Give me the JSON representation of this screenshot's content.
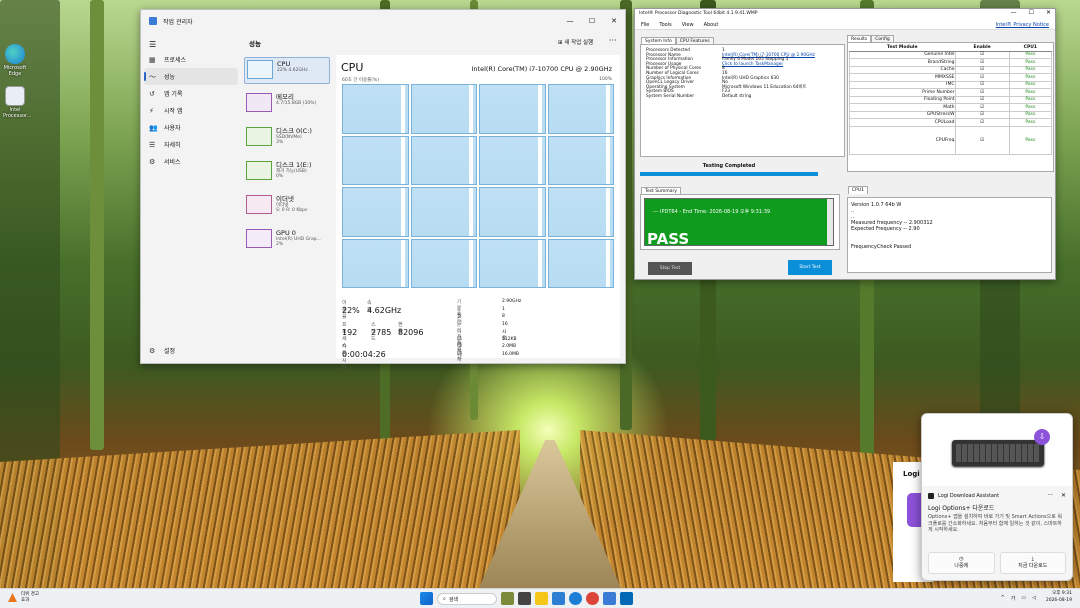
{
  "desktop": {
    "icons": [
      {
        "label": "Microsoft Edge"
      },
      {
        "label": "Intel Processor..."
      }
    ]
  },
  "taskmgr": {
    "title": "작업 관리자",
    "window_controls": [
      "—",
      "☐",
      "✕"
    ],
    "nav": [
      {
        "icon": "processes-icon",
        "glyph": "▦",
        "label": "프로세스"
      },
      {
        "icon": "performance-icon",
        "glyph": "〜",
        "label": "성능"
      },
      {
        "icon": "app-history-icon",
        "glyph": "↺",
        "label": "앱 기록"
      },
      {
        "icon": "startup-icon",
        "glyph": "⚡",
        "label": "시작 앱"
      },
      {
        "icon": "users-icon",
        "glyph": "👥",
        "label": "사용자"
      },
      {
        "icon": "details-icon",
        "glyph": "☰",
        "label": "자세히"
      },
      {
        "icon": "services-icon",
        "glyph": "⚙",
        "label": "서비스"
      }
    ],
    "settings_label": "설정",
    "section_title": "성능",
    "run_task_label": "새 작업 실행",
    "more_label": "···",
    "resources": [
      {
        "name": "CPU",
        "sub1": "22%  4.62GHz",
        "sub2": "",
        "kind": "cpu"
      },
      {
        "name": "메모리",
        "sub1": "4.7/15.8GB (30%)",
        "sub2": "",
        "kind": "mem"
      },
      {
        "name": "디스크 0(C:)",
        "sub1": "SSD(NVMe)",
        "sub2": "3%",
        "kind": "disk"
      },
      {
        "name": "디스크 1(E:)",
        "sub1": "제거 가능(USB)",
        "sub2": "0%",
        "kind": "disk"
      },
      {
        "name": "이더넷",
        "sub1": "이더넷",
        "sub2": "S: 0  R: 0 Kbps",
        "kind": "net"
      },
      {
        "name": "GPU 0",
        "sub1": "Intel(R) UHD Grap...",
        "sub2": "2%",
        "kind": "gpu"
      }
    ],
    "cpu": {
      "heading": "CPU",
      "model": "Intel(R) Core(TM) i7-10700 CPU @ 2.90GHz",
      "time_label": "60초 간 이용률(%)",
      "pct_label": "100%",
      "core_count": 16,
      "labels": {
        "util": "이용률",
        "speed": "속도",
        "proc": "프로세스",
        "threads": "스레드",
        "handles": "핸들",
        "uptime": "작동 시간"
      },
      "values": {
        "util": "22%",
        "speed": "4.62GHz",
        "proc": "192",
        "threads": "2785",
        "handles": "82096",
        "uptime": "0:00:04:26"
      },
      "specs": [
        {
          "k": "기본 속도:",
          "v": "2.90GHz"
        },
        {
          "k": "소켓:",
          "v": "1"
        },
        {
          "k": "코어:",
          "v": "8"
        },
        {
          "k": "논리 프로세서:",
          "v": "16"
        },
        {
          "k": "가상화:",
          "v": "사용"
        },
        {
          "k": "L1 캐시:",
          "v": "512KB"
        },
        {
          "k": "L2 캐시:",
          "v": "2.0MB"
        },
        {
          "k": "L3 캐시:",
          "v": "16.0MB"
        }
      ]
    }
  },
  "ipdt": {
    "title": "Intel® Processor Diagnostic Tool 64bit 4.1.9.41.WMP",
    "window_controls": [
      "—",
      "☐",
      "✕"
    ],
    "menu": [
      "File",
      "Tools",
      "View",
      "About"
    ],
    "privacy": "Intel® Privacy Notice",
    "tabs_left": [
      "System Info",
      "CPU Features"
    ],
    "sysinfo": [
      {
        "k": "Processors Detected",
        "v": "1",
        "link": false
      },
      {
        "k": "Processor Name",
        "v": "Intel(R) Core(TM) i7-10700 CPU @ 2.90GHz",
        "link": true
      },
      {
        "k": "Processor Information",
        "v": "Family 6 Model 165 Stepping 5",
        "link": false
      },
      {
        "k": "Processor Usage",
        "v": "Click to launch TaskManager",
        "link": true
      },
      {
        "k": "Number of Physical Cores",
        "v": "8",
        "link": false
      },
      {
        "k": "Number of Logical Cores",
        "v": "16",
        "link": false
      },
      {
        "k": "Graphics Information",
        "v": "Intel(R) UHD Graphics 630",
        "link": false
      },
      {
        "k": "OpenCL Legacy Driver",
        "v": "No",
        "link": false
      },
      {
        "k": "Operating System",
        "v": "Microsoft Windows 11 Education 64비트",
        "link": false
      },
      {
        "k": "System BIOS",
        "v": "F23",
        "link": false
      },
      {
        "k": "System Serial Number",
        "v": "Default string",
        "link": false
      }
    ],
    "testing_completed": "Testing Completed",
    "progress": 1.0,
    "summary_tab": "Test Summary",
    "summary_line": "--- IPDT64 - End Time: 2026-08-19 오후 9:31:39",
    "summary_pass": "PASS",
    "stop_label": "Stop Test",
    "start_label": "Start Test",
    "results_tabs": [
      "Results",
      "Config"
    ],
    "results_headers": [
      "Test Module",
      "Enable",
      "CPU1"
    ],
    "results": [
      {
        "module": "Genuine Intel",
        "enable": "☑",
        "cpu1": "Pass"
      },
      {
        "module": "BrandString",
        "enable": "☑",
        "cpu1": "Pass"
      },
      {
        "module": "Cache",
        "enable": "☑",
        "cpu1": "Pass"
      },
      {
        "module": "MMXSSE",
        "enable": "☑",
        "cpu1": "Pass"
      },
      {
        "module": "IMC",
        "enable": "☑",
        "cpu1": "Pass"
      },
      {
        "module": "Prime Number",
        "enable": "☑",
        "cpu1": "Pass"
      },
      {
        "module": "Floating Point",
        "enable": "☑",
        "cpu1": "Pass"
      },
      {
        "module": "Math",
        "enable": "☑",
        "cpu1": "Pass"
      },
      {
        "module": "GPUStressW",
        "enable": "☑",
        "cpu1": "Pass"
      },
      {
        "module": "CPULoad",
        "enable": "☑",
        "cpu1": "Pass"
      },
      {
        "module": "CPUFreq",
        "enable": "☑",
        "cpu1": "Pass"
      }
    ],
    "cpu1_tab": "CPU1",
    "cpu1_lines": [
      "Version 1.0.7 64b W",
      "..",
      "..",
      "Measured frequency -- 2.900312",
      "Expected Frequency -- 2.90",
      "",
      "",
      "FrequencyCheck Passed"
    ]
  },
  "notification": {
    "back_title": "Logi",
    "app_name": "Logi Download Assistant",
    "title": "Logi Options+ 다운로드",
    "body": "Options+ 앱을 설치하여 바로 가기 및 Smart Actions으로 워크플로를 간소화하세요. 처음부터 함께 일하는 것 같이, 스마트하게 시작하세요.",
    "later": "나중에",
    "download": "지금 다운로드",
    "more_icon": "···",
    "close_icon": "✕",
    "badge_icon": "⇩"
  },
  "taskbar": {
    "weather_title": "더위 경고",
    "weather_sub": "효과",
    "search_placeholder": "검색",
    "time": "오후 9:31",
    "date": "2026-08-19",
    "lang": "가",
    "colors": {
      "edge": "#1b7fd6",
      "explorer": "#f5c518",
      "store": "#2d7dd2",
      "chrome": "#db4437",
      "intel": "#0068b5"
    }
  }
}
